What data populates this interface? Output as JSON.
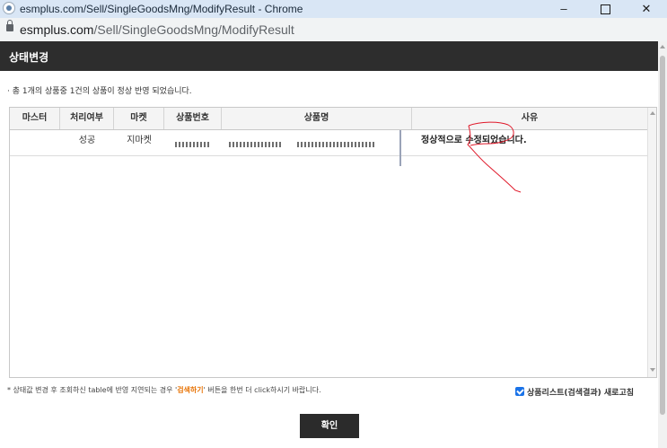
{
  "window": {
    "title": "esmplus.com/Sell/SingleGoodsMng/ModifyResult - Chrome",
    "minimize_glyph": "–",
    "close_glyph": "✕"
  },
  "address_bar": {
    "host": "esmplus.com",
    "path": "/Sell/SingleGoodsMng/ModifyResult"
  },
  "dialog": {
    "title": "상태변경",
    "summary": "· 총 1개의 상품중 1건의 상품이 정상 반영 되었습니다."
  },
  "table": {
    "columns": [
      "마스터",
      "처리여부",
      "마켓",
      "상품번호",
      "상품명",
      "사유"
    ],
    "rows": [
      {
        "master": "",
        "status": "성공",
        "market": "지마켓",
        "product_no": "",
        "product_name": "",
        "reason": "정상적으로 수정되었습니다."
      }
    ]
  },
  "footer": {
    "note_prefix": "* 상태값 변경 후 조회하신 table에 반영 지연되는 경우 '",
    "note_highlight": "검색하기",
    "note_suffix": "' 버튼을 한번 더 click하시기 바랍니다.",
    "refresh_label": "상품리스트(검색결과) 새로고침",
    "refresh_checked": true,
    "confirm_label": "확인"
  },
  "colors": {
    "header_bg": "#2d2d2d",
    "highlight": "#e8760a",
    "checkbox": "#1a73e8",
    "annotation": "#e0192a"
  }
}
